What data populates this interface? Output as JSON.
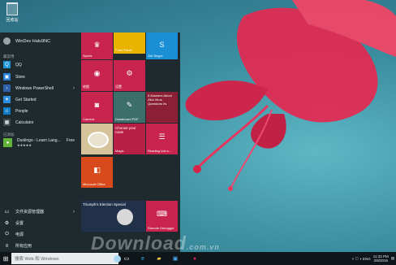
{
  "desktop": {
    "recycle_bin_label": "回收站"
  },
  "start_menu": {
    "user_name": "WinDev Halu9NC",
    "section_most_used": "最常用",
    "apps_most_used": [
      {
        "label": "QQ",
        "color": "#1e96d6",
        "icon": "qq-icon"
      },
      {
        "label": "Store",
        "color": "#2a7fd6",
        "icon": "store-icon"
      },
      {
        "label": "Windows PowerShell",
        "color": "#2e5fa8",
        "icon": "powershell-icon",
        "chevron": "›"
      },
      {
        "label": "Get Started",
        "color": "#2e8fe0",
        "icon": "lightbulb-icon"
      },
      {
        "label": "People",
        "color": "#0f7ac6",
        "icon": "people-icon"
      },
      {
        "label": "Calculator",
        "color": "#3c4a52",
        "icon": "calculator-icon"
      }
    ],
    "section_recently_added": "已添加",
    "recent_app": {
      "label": "Duolingo - Learn Lang...",
      "stars": "★★★★★",
      "extra": "Free",
      "color": "#64b43a"
    },
    "bottom_items": [
      {
        "label": "文件资源管理器",
        "chevron": "›",
        "icon": "folder-icon"
      },
      {
        "label": "设置",
        "icon": "gear-icon"
      },
      {
        "label": "电源",
        "icon": "power-icon"
      },
      {
        "label": "所有应用",
        "icon": "all-apps-icon"
      }
    ],
    "tiles": {
      "sports": "Sports",
      "front_panel": "Front Panel",
      "skype": "Get Skype",
      "t4": "地图",
      "t5": "设置",
      "camera": "Camera",
      "drawboard": "Drawboard PDF",
      "news": "5 Answers About Zika Virus Questions Its",
      "recipe": "",
      "magic": "Choose your route",
      "magic_sub": "Magic",
      "reading": "Reading List a...",
      "office": "Microsoft Office",
      "trumph": "Triumph's Election Special",
      "remote": "Remote Debugger"
    },
    "colors": {
      "accent": "#c8244f",
      "menu_bg": "#1f2a2e",
      "tile": "#c8244f"
    }
  },
  "taskbar": {
    "search_placeholder": "搜索 Web 和 Windows",
    "lang": "ENG",
    "time": "11:33 PM",
    "date": "2/8/2016"
  },
  "watermark": {
    "text": "Download",
    "suffix": ".com.vn"
  }
}
